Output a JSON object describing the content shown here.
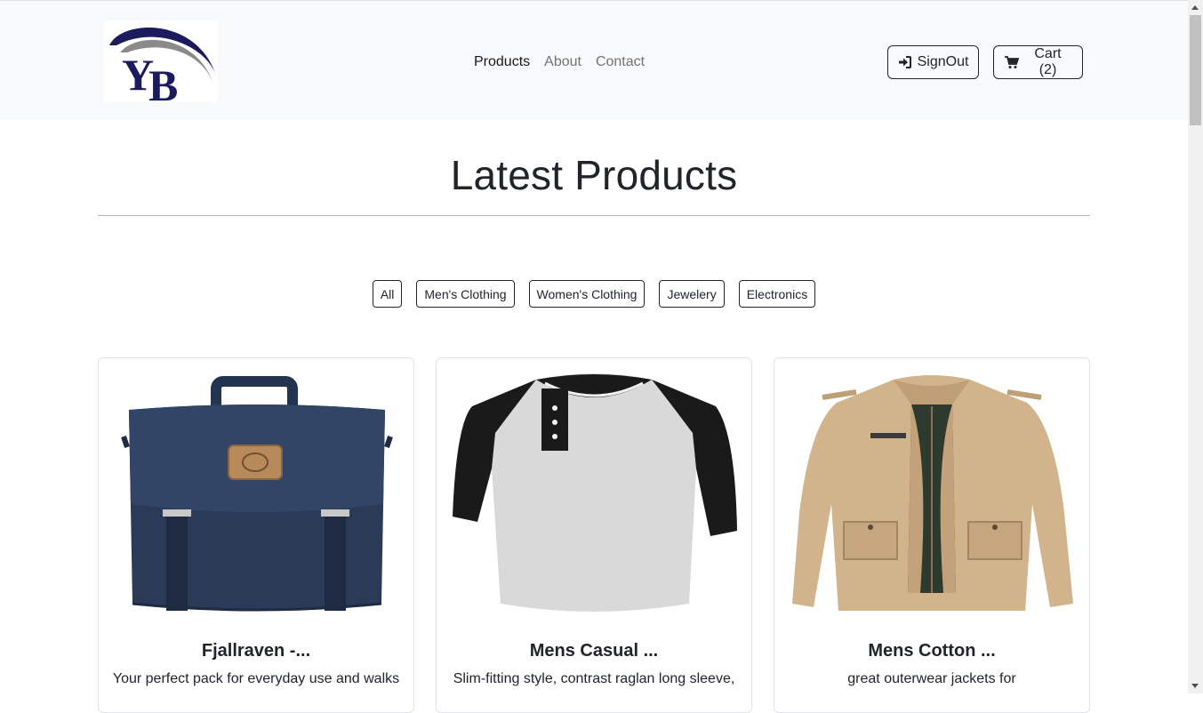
{
  "brand": {
    "logo_text": "YB"
  },
  "nav": {
    "links": [
      "Products",
      "About",
      "Contact"
    ],
    "signout_label": "SignOut",
    "cart_label": "Cart (2)"
  },
  "main": {
    "heading": "Latest Products",
    "filters": [
      "All",
      "Men's Clothing",
      "Women's Clothing",
      "Jewelery",
      "Electronics"
    ]
  },
  "products": [
    {
      "title": "Fjallraven -...",
      "description": "Your perfect pack for everyday use and walks",
      "icon": "backpack-image"
    },
    {
      "title": "Mens Casual ...",
      "description": "Slim-fitting style, contrast raglan long sleeve,",
      "icon": "raglan-shirt-image"
    },
    {
      "title": "Mens Cotton ...",
      "description": "great outerwear jackets for",
      "icon": "cotton-jacket-image"
    }
  ],
  "colors": {
    "navbar_bg": "#f8f9fa",
    "logo_navy": "#1b1b5e",
    "logo_gray": "#8a8a8a",
    "bag_navy": "#2b3b57",
    "jacket_tan": "#d2b48c"
  }
}
